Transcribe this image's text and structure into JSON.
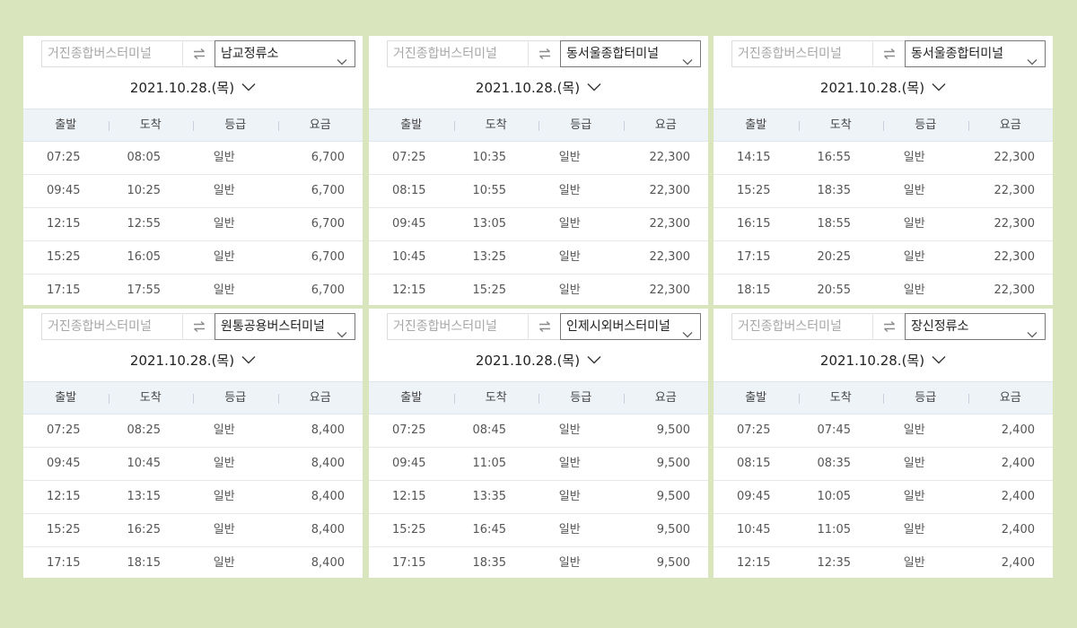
{
  "columns": {
    "departure": "출발",
    "arrival": "도착",
    "grade": "등급",
    "fare": "요금"
  },
  "panels": [
    {
      "origin": "거진종합버스터미널",
      "destination": "남교정류소",
      "date": "2021.10.28.(목)",
      "rows": [
        {
          "dep": "07:25",
          "arr": "08:05",
          "grade": "일반",
          "fare": "6,700"
        },
        {
          "dep": "09:45",
          "arr": "10:25",
          "grade": "일반",
          "fare": "6,700"
        },
        {
          "dep": "12:15",
          "arr": "12:55",
          "grade": "일반",
          "fare": "6,700"
        },
        {
          "dep": "15:25",
          "arr": "16:05",
          "grade": "일반",
          "fare": "6,700"
        },
        {
          "dep": "17:15",
          "arr": "17:55",
          "grade": "일반",
          "fare": "6,700"
        }
      ]
    },
    {
      "origin": "거진종합버스터미널",
      "destination": "동서울종합터미널",
      "date": "2021.10.28.(목)",
      "rows": [
        {
          "dep": "07:25",
          "arr": "10:35",
          "grade": "일반",
          "fare": "22,300"
        },
        {
          "dep": "08:15",
          "arr": "10:55",
          "grade": "일반",
          "fare": "22,300"
        },
        {
          "dep": "09:45",
          "arr": "13:05",
          "grade": "일반",
          "fare": "22,300"
        },
        {
          "dep": "10:45",
          "arr": "13:25",
          "grade": "일반",
          "fare": "22,300"
        },
        {
          "dep": "12:15",
          "arr": "15:25",
          "grade": "일반",
          "fare": "22,300"
        }
      ]
    },
    {
      "origin": "거진종합버스터미널",
      "destination": "동서울종합터미널",
      "date": "2021.10.28.(목)",
      "rows": [
        {
          "dep": "14:15",
          "arr": "16:55",
          "grade": "일반",
          "fare": "22,300"
        },
        {
          "dep": "15:25",
          "arr": "18:35",
          "grade": "일반",
          "fare": "22,300"
        },
        {
          "dep": "16:15",
          "arr": "18:55",
          "grade": "일반",
          "fare": "22,300"
        },
        {
          "dep": "17:15",
          "arr": "20:25",
          "grade": "일반",
          "fare": "22,300"
        },
        {
          "dep": "18:15",
          "arr": "20:55",
          "grade": "일반",
          "fare": "22,300"
        }
      ]
    },
    {
      "origin": "거진종합버스터미널",
      "destination": "원통공용버스터미널",
      "date": "2021.10.28.(목)",
      "rows": [
        {
          "dep": "07:25",
          "arr": "08:25",
          "grade": "일반",
          "fare": "8,400"
        },
        {
          "dep": "09:45",
          "arr": "10:45",
          "grade": "일반",
          "fare": "8,400"
        },
        {
          "dep": "12:15",
          "arr": "13:15",
          "grade": "일반",
          "fare": "8,400"
        },
        {
          "dep": "15:25",
          "arr": "16:25",
          "grade": "일반",
          "fare": "8,400"
        },
        {
          "dep": "17:15",
          "arr": "18:15",
          "grade": "일반",
          "fare": "8,400"
        }
      ]
    },
    {
      "origin": "거진종합버스터미널",
      "destination": "인제시외버스터미널",
      "date": "2021.10.28.(목)",
      "rows": [
        {
          "dep": "07:25",
          "arr": "08:45",
          "grade": "일반",
          "fare": "9,500"
        },
        {
          "dep": "09:45",
          "arr": "11:05",
          "grade": "일반",
          "fare": "9,500"
        },
        {
          "dep": "12:15",
          "arr": "13:35",
          "grade": "일반",
          "fare": "9,500"
        },
        {
          "dep": "15:25",
          "arr": "16:45",
          "grade": "일반",
          "fare": "9,500"
        },
        {
          "dep": "17:15",
          "arr": "18:35",
          "grade": "일반",
          "fare": "9,500"
        }
      ]
    },
    {
      "origin": "거진종합버스터미널",
      "destination": "장신정류소",
      "date": "2021.10.28.(목)",
      "rows": [
        {
          "dep": "07:25",
          "arr": "07:45",
          "grade": "일반",
          "fare": "2,400"
        },
        {
          "dep": "08:15",
          "arr": "08:35",
          "grade": "일반",
          "fare": "2,400"
        },
        {
          "dep": "09:45",
          "arr": "10:05",
          "grade": "일반",
          "fare": "2,400"
        },
        {
          "dep": "10:45",
          "arr": "11:05",
          "grade": "일반",
          "fare": "2,400"
        },
        {
          "dep": "12:15",
          "arr": "12:35",
          "grade": "일반",
          "fare": "2,400"
        }
      ]
    }
  ],
  "colors": {
    "background": "#d9e5bd",
    "header_bg": "#eef3f8"
  },
  "icons": {
    "swap": "swap-arrows-icon",
    "dropdown": "chevron-down-icon"
  }
}
